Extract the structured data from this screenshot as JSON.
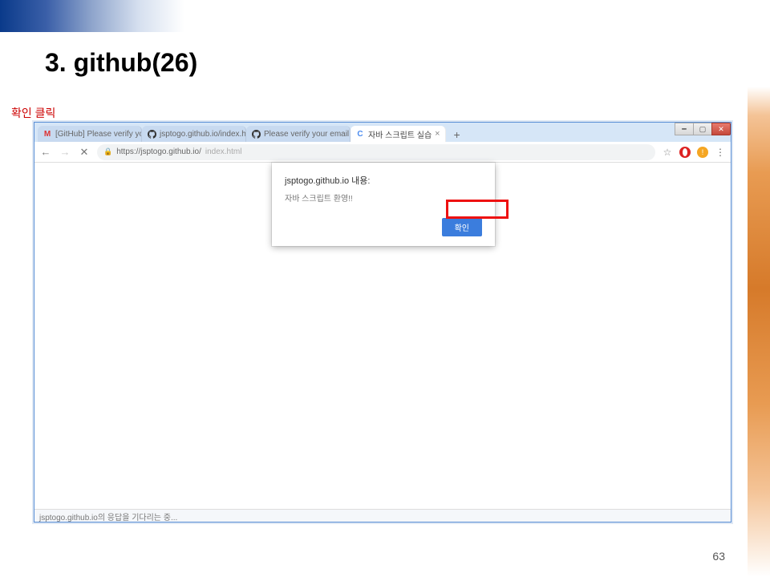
{
  "slide": {
    "title": "3. github(26)",
    "note": "확인 클릭",
    "page_number": "63"
  },
  "browser": {
    "tabs": [
      {
        "label": "[GitHub] Please verify your em…",
        "icon": "gmail"
      },
      {
        "label": "jsptogo.github.io/index.html at …",
        "icon": "github"
      },
      {
        "label": "Please verify your email address",
        "icon": "github"
      },
      {
        "label": "자바 스크립트 실습",
        "icon": "page",
        "active": true
      }
    ],
    "url_prefix": "https://jsptogo.github.io/",
    "url_path": "index.html",
    "status": "jsptogo.github.io의 응답을 기다리는 중..."
  },
  "dialog": {
    "title": "jsptogo.github.io 내용:",
    "message": "자바 스크립트 환영!!",
    "ok": "확인"
  }
}
